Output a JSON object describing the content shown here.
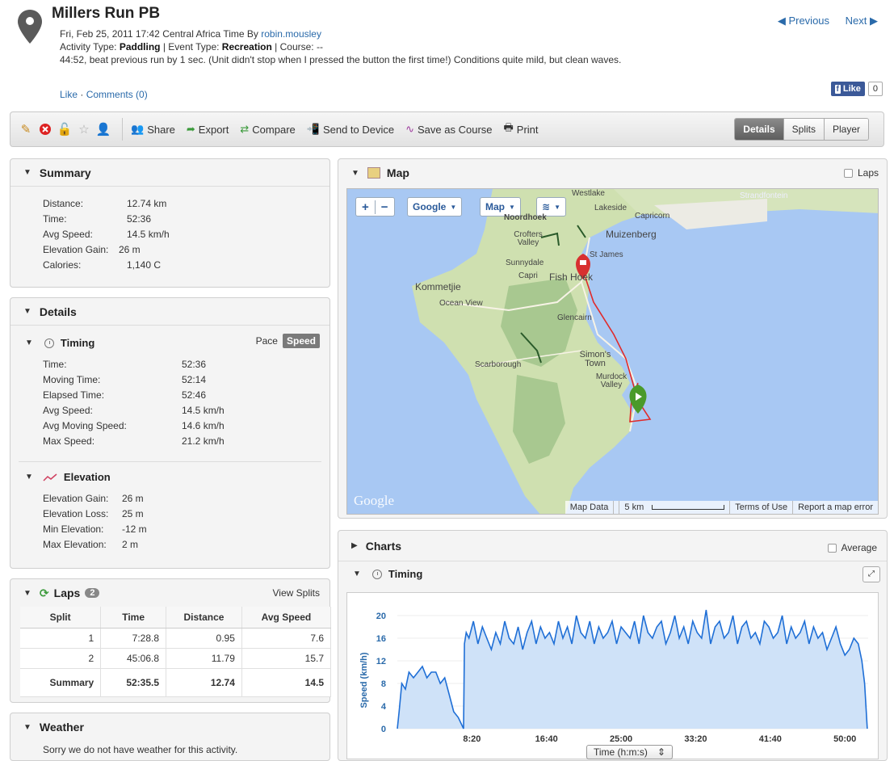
{
  "header": {
    "title": "Millers Run PB",
    "datetime": "Fri, Feb 25, 2011 17:42 Central Africa Time",
    "by_label": "By",
    "user": "robin.mousley",
    "activity_type_label": "Activity Type:",
    "activity_type": "Paddling",
    "event_type_label": "| Event Type:",
    "event_type": "Recreation",
    "course_label": "| Course: --",
    "description": "44:52, beat previous run by 1 sec. (Unit didn't stop when I pressed the button the first time!) Conditions quite mild, but clean waves.",
    "like": "Like",
    "separator": "·",
    "comments": "Comments (0)",
    "previous": "Previous",
    "next": "Next",
    "fb_like": "Like",
    "fb_count": "0"
  },
  "toolbar": {
    "share": "Share",
    "export": "Export",
    "compare": "Compare",
    "send": "Send to Device",
    "save_course": "Save as Course",
    "print": "Print",
    "tabs": [
      "Details",
      "Splits",
      "Player"
    ]
  },
  "summary": {
    "title": "Summary",
    "rows": [
      {
        "k": "Distance:",
        "v": "12.74 km"
      },
      {
        "k": "Time:",
        "v": "52:36"
      },
      {
        "k": "Avg Speed:",
        "v": "14.5 km/h"
      },
      {
        "k": "Elevation Gain:",
        "v": "26 m"
      },
      {
        "k": "Calories:",
        "v": "1,140 C"
      }
    ]
  },
  "details": {
    "title": "Details",
    "timing_title": "Timing",
    "pace": "Pace",
    "speed": "Speed",
    "timing_rows": [
      {
        "k": "Time:",
        "v": "52:36"
      },
      {
        "k": "Moving Time:",
        "v": "52:14"
      },
      {
        "k": "Elapsed Time:",
        "v": "52:46"
      },
      {
        "k": "Avg Speed:",
        "v": "14.5 km/h"
      },
      {
        "k": "Avg Moving Speed:",
        "v": "14.6 km/h"
      },
      {
        "k": "Max Speed:",
        "v": "21.2 km/h"
      }
    ],
    "elevation_title": "Elevation",
    "elevation_rows": [
      {
        "k": "Elevation Gain:",
        "v": "26 m"
      },
      {
        "k": "Elevation Loss:",
        "v": "25 m"
      },
      {
        "k": "Min Elevation:",
        "v": "-12 m"
      },
      {
        "k": "Max Elevation:",
        "v": "2 m"
      }
    ]
  },
  "laps": {
    "title": "Laps",
    "count": "2",
    "view_splits": "View Splits",
    "columns": [
      "Split",
      "Time",
      "Distance",
      "Avg Speed"
    ],
    "rows": [
      [
        "1",
        "7:28.8",
        "0.95",
        "7.6"
      ],
      [
        "2",
        "45:06.8",
        "11.79",
        "15.7"
      ]
    ],
    "summary": [
      "Summary",
      "52:35.5",
      "12.74",
      "14.5"
    ]
  },
  "weather": {
    "title": "Weather",
    "message": "Sorry we do not have weather for this activity."
  },
  "map": {
    "title": "Map",
    "laps": "Laps",
    "provider": "Google",
    "view": "Map",
    "zoom_in": "+",
    "zoom_out": "−",
    "logo": "Google",
    "footer": [
      "Map Data",
      "5 km",
      "Terms of Use",
      "Report a map error"
    ],
    "places": [
      "Westlake",
      "Lakeside",
      "Capricorn",
      "Strandfontein",
      "Noordhoek",
      "Crofters Valley",
      "Muizenberg",
      "St James",
      "Sunnydale",
      "Capri",
      "Fish Hoek",
      "Kommetjie",
      "Ocean View",
      "Glencairn",
      "Simon's Town",
      "Scarborough",
      "Murdock Valley"
    ]
  },
  "charts": {
    "title": "Charts",
    "average": "Average",
    "section": "Timing",
    "time_select": "Time (h:m:s)",
    "select_arrow": "⇕"
  },
  "chart_data": {
    "type": "area",
    "ylabel": "Speed (km/h)",
    "xlabel": "Time (h:m:s)",
    "ylim": [
      0,
      22
    ],
    "yticks": [
      0,
      4,
      8,
      12,
      16,
      20
    ],
    "xticks": [
      "8:20",
      "16:40",
      "25:00",
      "33:20",
      "41:40",
      "50:00"
    ],
    "x_tick_minutes": [
      8.333,
      16.667,
      25,
      33.333,
      41.667,
      50
    ],
    "xlim_minutes": [
      0,
      52.6
    ],
    "series": [
      {
        "color": "#1f6fd6",
        "x_minutes": [
          0,
          0.2,
          0.5,
          0.9,
          1.3,
          1.8,
          2.3,
          2.8,
          3.3,
          3.8,
          4.3,
          4.8,
          5.3,
          5.8,
          6.3,
          6.8,
          7.1,
          7.4,
          7.5,
          7.7,
          8.0,
          8.5,
          9.0,
          9.5,
          10.0,
          10.5,
          11.0,
          11.5,
          12.0,
          12.5,
          13.0,
          13.5,
          14.0,
          14.5,
          15.0,
          15.5,
          16.0,
          16.5,
          17.0,
          17.5,
          18.0,
          18.5,
          19.0,
          19.5,
          20.0,
          20.5,
          21.0,
          21.5,
          22.0,
          22.5,
          23.0,
          23.5,
          24.0,
          24.5,
          25.0,
          25.5,
          26.0,
          26.5,
          27.0,
          27.5,
          28.0,
          28.5,
          29.0,
          29.5,
          30.0,
          30.5,
          31.0,
          31.5,
          32.0,
          32.5,
          33.0,
          33.5,
          34.0,
          34.5,
          35.0,
          35.5,
          36.0,
          36.5,
          37.0,
          37.5,
          38.0,
          38.5,
          39.0,
          39.5,
          40.0,
          40.5,
          41.0,
          41.5,
          42.0,
          42.5,
          43.0,
          43.5,
          44.0,
          44.5,
          45.0,
          45.5,
          46.0,
          46.5,
          47.0,
          47.5,
          48.0,
          48.5,
          49.0,
          49.5,
          50.0,
          50.5,
          51.0,
          51.5,
          51.9,
          52.2,
          52.5
        ],
        "y": [
          0,
          3,
          8,
          7,
          10,
          9,
          10,
          11,
          9,
          10,
          10,
          8,
          9,
          6,
          3,
          2,
          1,
          0,
          15,
          17,
          16,
          19,
          15,
          18,
          16,
          14,
          17,
          15,
          19,
          16,
          15,
          18,
          14,
          17,
          19,
          15,
          18,
          16,
          17,
          15,
          19,
          16,
          18,
          15,
          20,
          17,
          16,
          19,
          15,
          18,
          16,
          17,
          19,
          15,
          18,
          17,
          16,
          19,
          15,
          20,
          17,
          16,
          18,
          19,
          15,
          17,
          20,
          16,
          18,
          15,
          19,
          17,
          16,
          21,
          15,
          18,
          19,
          16,
          17,
          20,
          15,
          18,
          19,
          16,
          17,
          15,
          19,
          18,
          16,
          17,
          20,
          15,
          18,
          16,
          17,
          19,
          15,
          18,
          16,
          17,
          14,
          16,
          18,
          15,
          13,
          14,
          16,
          15,
          12,
          8,
          0
        ]
      }
    ]
  }
}
